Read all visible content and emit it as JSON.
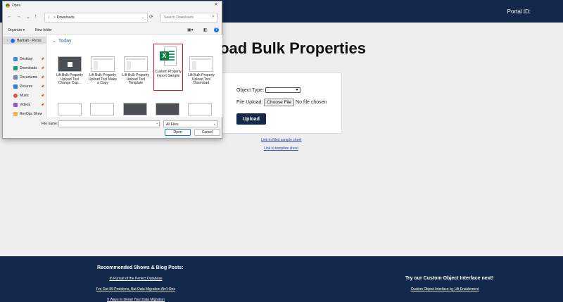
{
  "page": {
    "portal_label": "Portal ID:",
    "title": "load Bulk Properties",
    "form": {
      "object_type_label": "Object Type:",
      "file_upload_label": "File Upload:",
      "choose_file": "Choose File",
      "no_file": "No file chosen",
      "upload": "Upload"
    },
    "links": {
      "filled_sample": "Link to filled sample sheet",
      "template": "Link to template sheet"
    },
    "footer": {
      "left_title": "Recommended Shows & Blog Posts:",
      "left_links": [
        "In Pursuit of the Perfect Database",
        "I've Got 99 Problems, But Data Migration Ain't One",
        "9 Ways to Derail Your Data Migration"
      ],
      "right_title": "Try our Custom Object Interface next!",
      "right_link": "Custom Object Interface by Lift Enablement"
    },
    "colors": {
      "navy": "#13294b",
      "selection_border": "#e12020",
      "excel_green": "#107c41"
    }
  },
  "dialog": {
    "title": "Open",
    "nav": {
      "back": "←",
      "forward": "→",
      "recent": "⌄",
      "up": "↑"
    },
    "address": {
      "icon": "↓",
      "separator": ">",
      "path": "Downloads",
      "dropdown": "⌄"
    },
    "refresh": "⟳",
    "search_placeholder": "Search Downloads",
    "toolbar": {
      "organize": "Organize ▾",
      "new_folder": "New folder",
      "help": "?"
    },
    "window_controls": {
      "close": "✕"
    },
    "sidebar": [
      {
        "label": "Hannah - Perso",
        "icon": "cloud-icon",
        "selected": true
      },
      {
        "label": "Desktop",
        "icon": "desktop-icon"
      },
      {
        "label": "Downloads",
        "icon": "download-icon"
      },
      {
        "label": "Documents",
        "icon": "documents-icon"
      },
      {
        "label": "Pictures",
        "icon": "pictures-icon"
      },
      {
        "label": "Music",
        "icon": "music-icon"
      },
      {
        "label": "Videos",
        "icon": "videos-icon"
      },
      {
        "label": "RevOps Show",
        "icon": "folder-icon"
      }
    ],
    "pin_glyph": "📌",
    "group_title": "Today",
    "files": [
      {
        "name": "Lift Bulk Property Upload Tool Change Cop...",
        "thumb": "dark"
      },
      {
        "name": "Lift Bulk Property Upload Tool Make a Copy",
        "thumb": "light"
      },
      {
        "name": "Lift Bulk Property Upload Tool Template",
        "thumb": "light"
      },
      {
        "name": "Custom Property Import Sample",
        "thumb": "excel",
        "selected": true
      },
      {
        "name": "Lift Bulk Property Upload Tool Download",
        "thumb": "light"
      }
    ],
    "excel_letter": "X",
    "file_name_label": "File name:",
    "file_name_value": "",
    "file_type": "All Files",
    "open": "Open",
    "cancel": "Cancel"
  }
}
